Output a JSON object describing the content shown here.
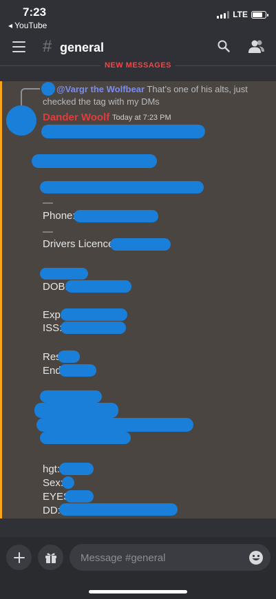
{
  "status_bar": {
    "time": "7:23",
    "back_app": "◂ YouTube",
    "network": "LTE"
  },
  "header": {
    "channel_name": "general"
  },
  "divider": {
    "label": "NEW MESSAGES"
  },
  "reply": {
    "mention": "@Vargr the Wolfbear",
    "text": "That’s one of his alts, just checked the tag with my DMs"
  },
  "message": {
    "author": "Dander Woolf",
    "timestamp": "Today at 7:23 PM",
    "lines": {
      "dash1": "—",
      "phone": "Phone:",
      "dash2": "—",
      "licence": "Drivers Licence",
      "dob": "DOB:",
      "exp": "Exp:",
      "iss": "ISS:",
      "res": "Res",
      "end": "End",
      "hgt": "hgt:",
      "sex": "Sex:",
      "eyes": "EYES",
      "dd": "DD:"
    }
  },
  "composer": {
    "placeholder": "Message #general"
  },
  "colors": {
    "background": "#2f3136",
    "highlight": "#4a4541",
    "mention_bar": "#faa61a",
    "author": "#e03c3c",
    "redaction": "#1a7fd9"
  }
}
